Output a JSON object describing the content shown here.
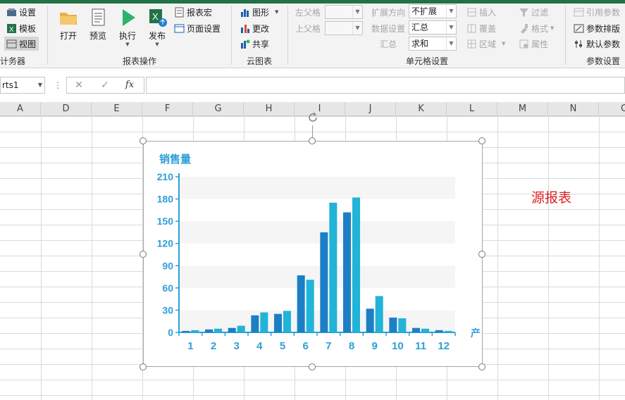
{
  "ribbon": {
    "designer_group": {
      "items": [
        {
          "label": "设置",
          "icon": "settings-icon"
        },
        {
          "label": "模板",
          "icon": "excel-template-icon"
        },
        {
          "label": "视图",
          "icon": "view-icon"
        }
      ],
      "label": "计务器"
    },
    "report_ops": {
      "buttons": [
        {
          "label": "打开",
          "icon": "folder-open-icon"
        },
        {
          "label": "预览",
          "icon": "preview-document-icon"
        },
        {
          "label": "执行",
          "icon": "play-icon"
        },
        {
          "label": "发布",
          "icon": "excel-publish-icon"
        }
      ],
      "small": [
        {
          "label": "报表宏",
          "icon": "macro-icon"
        },
        {
          "label": "页面设置",
          "icon": "page-setup-icon"
        }
      ],
      "label": "报表操作"
    },
    "cloud_chart": {
      "items": [
        {
          "label": "图形",
          "icon": "chart-icon"
        },
        {
          "label": "更改",
          "icon": "change-chart-icon"
        },
        {
          "label": "共享",
          "icon": "share-icon"
        }
      ],
      "label": "云图表"
    },
    "cell_settings": {
      "left_parent_label": "左父格",
      "top_parent_label": "上父格",
      "expand_dir_label": "扩展方向",
      "expand_dir_value": "不扩展",
      "data_setting_label": "数据设置",
      "data_setting_value": "汇总",
      "summary_label": "汇总",
      "summary_value": "求和",
      "insert_label": "插入",
      "cover_label": "覆盖",
      "area_label": "区域",
      "label": "单元格设置"
    },
    "format_group": {
      "filter_label": "过滤",
      "format_label": "格式",
      "property_label": "属性"
    },
    "param_settings": {
      "items": [
        {
          "label": "引用参数"
        },
        {
          "label": "参数排版"
        },
        {
          "label": "默认参数"
        }
      ],
      "label": "参数设置"
    }
  },
  "formula_bar": {
    "name_box": "rts1",
    "fx": "fx",
    "value": ""
  },
  "columns": [
    "A",
    "D",
    "E",
    "F",
    "G",
    "H",
    "I",
    "J",
    "K",
    "L",
    "M",
    "N",
    "C"
  ],
  "source_label": "源报表",
  "chart_data": {
    "type": "bar",
    "title": "销售量",
    "xlabel": "产",
    "categories": [
      "1",
      "2",
      "3",
      "4",
      "5",
      "6",
      "7",
      "8",
      "9",
      "10",
      "11",
      "12"
    ],
    "series": [
      {
        "values": [
          2,
          4,
          6,
          23,
          25,
          77,
          135,
          162,
          32,
          20,
          6,
          3
        ]
      },
      {
        "values": [
          3,
          5,
          9,
          27,
          29,
          71,
          175,
          182,
          49,
          19,
          5,
          2
        ]
      }
    ],
    "ylim": [
      0,
      210
    ],
    "yticks": [
      0,
      30,
      60,
      90,
      120,
      150,
      180,
      210
    ],
    "colors": [
      "#1c7fc6",
      "#22b3d8"
    ],
    "axis_color": "#2e9fd8"
  }
}
